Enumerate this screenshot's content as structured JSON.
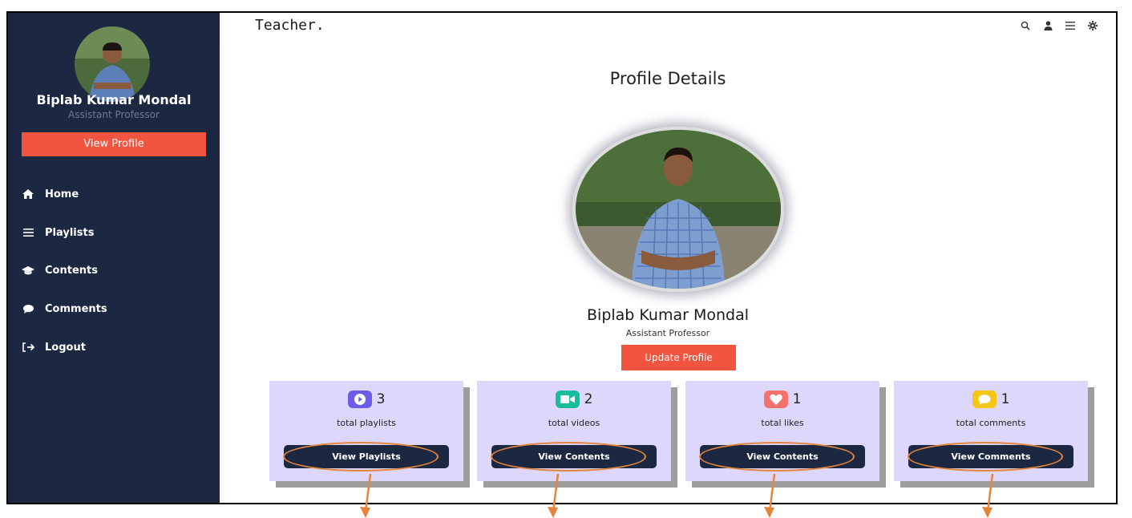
{
  "sidebar": {
    "name": "Biplab Kumar Mondal",
    "role": "Assistant Professor",
    "view_profile_label": "View Profile",
    "nav": [
      {
        "label": "Home",
        "icon": "home-icon"
      },
      {
        "label": "Playlists",
        "icon": "bars-icon"
      },
      {
        "label": "Contents",
        "icon": "graduation-cap-icon"
      },
      {
        "label": "Comments",
        "icon": "comment-icon"
      },
      {
        "label": "Logout",
        "icon": "logout-icon"
      }
    ]
  },
  "topbar": {
    "brand": "Teacher.",
    "icons": [
      "search-icon",
      "user-icon",
      "menu-icon",
      "settings-icon"
    ]
  },
  "main": {
    "title": "Profile Details",
    "name": "Biplab Kumar Mondal",
    "role": "Assistant Professor",
    "update_label": "Update Profile"
  },
  "cards": [
    {
      "count": "3",
      "label": "total playlists",
      "button": "View Playlists",
      "icon": "play-icon",
      "icon_color": "#6c5ce7"
    },
    {
      "count": "2",
      "label": "total videos",
      "button": "View Contents",
      "icon": "video-camera-icon",
      "icon_color": "#1abc9c"
    },
    {
      "count": "1",
      "label": "total likes",
      "button": "View Contents",
      "icon": "heart-icon",
      "icon_color": "#f4726b"
    },
    {
      "count": "1",
      "label": "total comments",
      "button": "View Comments",
      "icon": "comment-icon",
      "icon_color": "#f5c518"
    }
  ],
  "colors": {
    "sidebar_bg": "#1c2841",
    "accent": "#f2543f",
    "card_bg": "#dcd7fb",
    "annotation": "#e5843b"
  }
}
